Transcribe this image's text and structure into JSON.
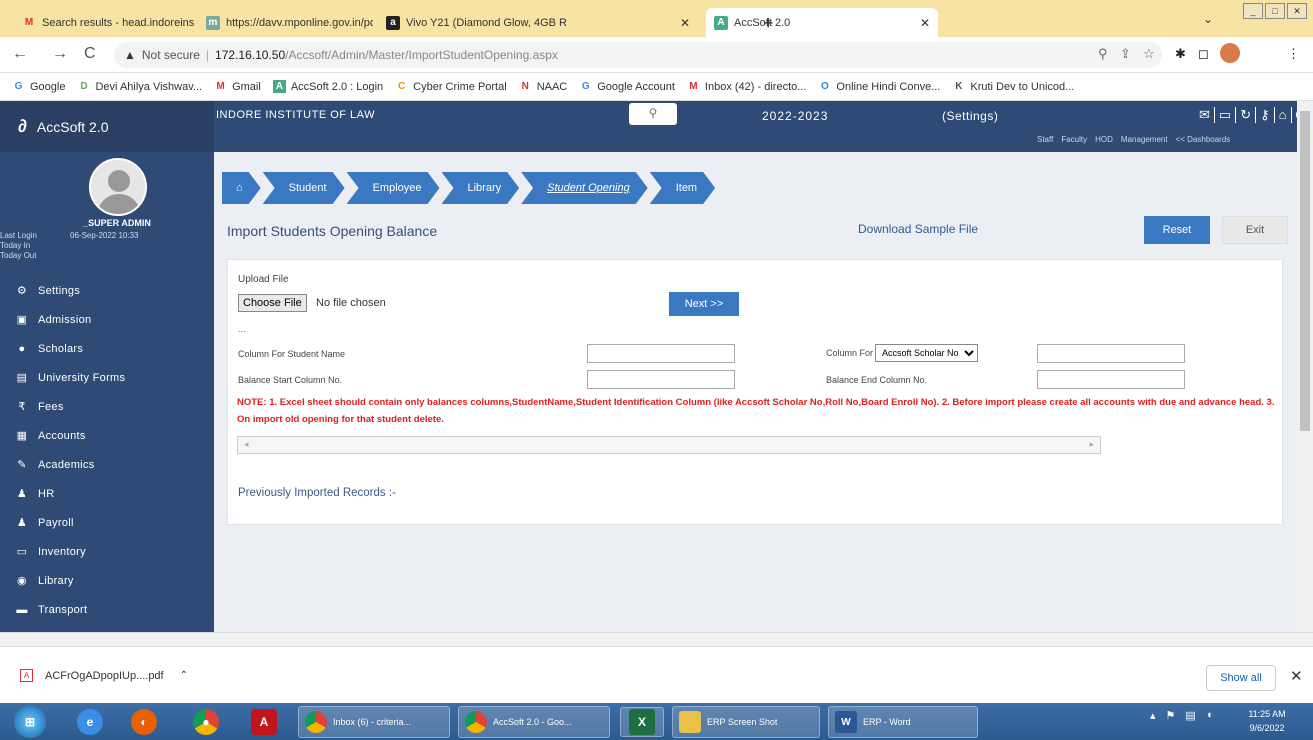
{
  "browser": {
    "tabs": [
      {
        "title": "Search results - head.indoreinstit",
        "icon": "gmail-icon"
      },
      {
        "title": "https://davv.mponline.gov.in/po",
        "icon": "mponline-icon"
      },
      {
        "title": "Vivo Y21 (Diamond Glow, 4GB R",
        "icon": "amazon-icon"
      },
      {
        "title": "AccSoft 2.0",
        "icon": "accsoft-icon"
      }
    ],
    "new_tab": "+",
    "address": {
      "security": "Not secure",
      "host": "172.16.10.50",
      "path": "/Accsoft/Admin/Master/ImportStudentOpening.aspx"
    },
    "bookmarks": [
      {
        "label": "Google",
        "icon": "G"
      },
      {
        "label": "Devi Ahilya Vishwav...",
        "icon": "D"
      },
      {
        "label": "Gmail",
        "icon": "M"
      },
      {
        "label": "AccSoft 2.0 : Login",
        "icon": "A"
      },
      {
        "label": "Cyber Crime Portal",
        "icon": "C"
      },
      {
        "label": "NAAC",
        "icon": "N"
      },
      {
        "label": "Google Account",
        "icon": "G"
      },
      {
        "label": "Inbox (42) - directo...",
        "icon": "M"
      },
      {
        "label": "Online Hindi Conve...",
        "icon": "O"
      },
      {
        "label": "Kruti Dev to Unicod...",
        "icon": "K"
      }
    ]
  },
  "app": {
    "logo_text": "AccSoft 2.0",
    "institute": "INDORE INSTITUTE OF LAW",
    "session": "2022-2023",
    "settings_link": "(Settings)",
    "roles": [
      "Staff",
      "Faculty",
      "HOD",
      "Management",
      "<< Dashboards"
    ]
  },
  "sidebar": {
    "user_name": "_SUPER ADMIN",
    "last_login_label": "Last Login",
    "last_login_value": "06-Sep-2022 10:33",
    "today_in_label": "Today In",
    "today_out_label": "Today Out",
    "menu": [
      {
        "label": "Settings",
        "icon": "gear-icon",
        "glyph": "⚙"
      },
      {
        "label": "Admission",
        "icon": "admission-icon",
        "glyph": "▣"
      },
      {
        "label": "Scholars",
        "icon": "user-icon",
        "glyph": "●"
      },
      {
        "label": "University Forms",
        "icon": "form-icon",
        "glyph": "▤"
      },
      {
        "label": "Fees",
        "icon": "rupee-icon",
        "glyph": "₹"
      },
      {
        "label": "Accounts",
        "icon": "accounts-icon",
        "glyph": "▦"
      },
      {
        "label": "Academics",
        "icon": "pencil-icon",
        "glyph": "✎"
      },
      {
        "label": "HR",
        "icon": "people-icon",
        "glyph": "♟"
      },
      {
        "label": "Payroll",
        "icon": "people-icon",
        "glyph": "♟"
      },
      {
        "label": "Inventory",
        "icon": "inventory-icon",
        "glyph": "▭"
      },
      {
        "label": "Library",
        "icon": "library-icon",
        "glyph": "◉"
      },
      {
        "label": "Transport",
        "icon": "bus-icon",
        "glyph": "▬"
      }
    ]
  },
  "breadcrumb": [
    "Student",
    "Employee",
    "Library",
    "Student Opening",
    "Item"
  ],
  "page": {
    "title": "Import Students Opening Balance",
    "download_sample": "Download Sample File",
    "reset": "Reset",
    "exit": "Exit",
    "upload_label": "Upload File",
    "choose_file": "Choose File",
    "no_file": "No file chosen",
    "dots": "...",
    "next": "Next >>",
    "col_student_name": "Column For Student Name",
    "col_for": "Column For",
    "col_for_selected": "Accsoft Scholar No",
    "balance_start": "Balance Start Column No.",
    "balance_end": "Balance End Column No.",
    "note": "NOTE: 1. Excel sheet should contain only balances columns,StudentName,Student Identification Column (like Accsoft Scholar No,Roll No,Board Enroll No). 2. Before import please create all accounts with due and advance head. 3. On import old opening for that student delete.",
    "previously_imported": "Previously Imported Records :-"
  },
  "downloads": {
    "file": "ACFrOgADpopIUp....pdf",
    "show_all": "Show all"
  },
  "taskbar": {
    "tasks": [
      "Inbox (6) - criteria...",
      "AccSoft 2.0 - Goo...",
      "ERP Screen Shot",
      "ERP - Word"
    ],
    "time": "11:25 AM",
    "date": "9/6/2022"
  },
  "colors": {
    "header": "#2f4a75",
    "accent": "#3a78c2",
    "note": "#e02020",
    "tabbar": "#f7e3a3"
  }
}
